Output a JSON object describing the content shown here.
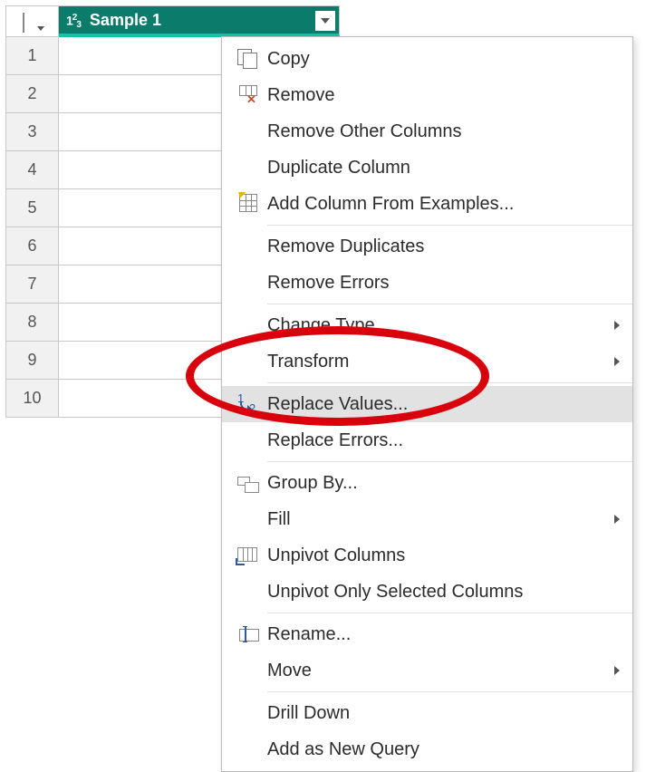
{
  "column": {
    "name": "Sample 1",
    "type_label": "1²3",
    "type_icon": "whole-number-icon"
  },
  "rows": [
    {
      "index": 1
    },
    {
      "index": 2
    },
    {
      "index": 3
    },
    {
      "index": 4
    },
    {
      "index": 5
    },
    {
      "index": 6
    },
    {
      "index": 7
    },
    {
      "index": 8
    },
    {
      "index": 9
    },
    {
      "index": 10
    }
  ],
  "menu": {
    "groups": [
      {
        "items": [
          {
            "id": "copy",
            "label": "Copy",
            "icon": "copy-icon"
          },
          {
            "id": "remove",
            "label": "Remove",
            "icon": "remove-column-icon"
          },
          {
            "id": "remove-other",
            "label": "Remove Other Columns",
            "icon": null
          },
          {
            "id": "duplicate",
            "label": "Duplicate Column",
            "icon": null
          },
          {
            "id": "add-from-examples",
            "label": "Add Column From Examples...",
            "icon": "add-column-examples-icon"
          }
        ]
      },
      {
        "items": [
          {
            "id": "remove-dup",
            "label": "Remove Duplicates",
            "icon": null
          },
          {
            "id": "remove-err",
            "label": "Remove Errors",
            "icon": null
          }
        ]
      },
      {
        "items": [
          {
            "id": "change-type",
            "label": "Change Type",
            "icon": null,
            "submenu": true
          },
          {
            "id": "transform",
            "label": "Transform",
            "icon": null,
            "submenu": true
          }
        ]
      },
      {
        "items": [
          {
            "id": "replace-values",
            "label": "Replace Values...",
            "icon": "replace-values-icon",
            "highlight": true
          },
          {
            "id": "replace-errors",
            "label": "Replace Errors...",
            "icon": null
          }
        ]
      },
      {
        "items": [
          {
            "id": "group-by",
            "label": "Group By...",
            "icon": "group-by-icon"
          },
          {
            "id": "fill",
            "label": "Fill",
            "icon": null,
            "submenu": true
          },
          {
            "id": "unpivot",
            "label": "Unpivot Columns",
            "icon": "unpivot-icon"
          },
          {
            "id": "unpivot-sel",
            "label": "Unpivot Only Selected Columns",
            "icon": null
          }
        ]
      },
      {
        "items": [
          {
            "id": "rename",
            "label": "Rename...",
            "icon": "rename-icon"
          },
          {
            "id": "move",
            "label": "Move",
            "icon": null,
            "submenu": true
          }
        ]
      },
      {
        "items": [
          {
            "id": "drill",
            "label": "Drill Down",
            "icon": null
          },
          {
            "id": "add-query",
            "label": "Add as New Query",
            "icon": null
          }
        ]
      }
    ]
  },
  "annotation": {
    "kind": "highlight-ellipse",
    "target": "replace-values",
    "color": "#d8000c"
  }
}
